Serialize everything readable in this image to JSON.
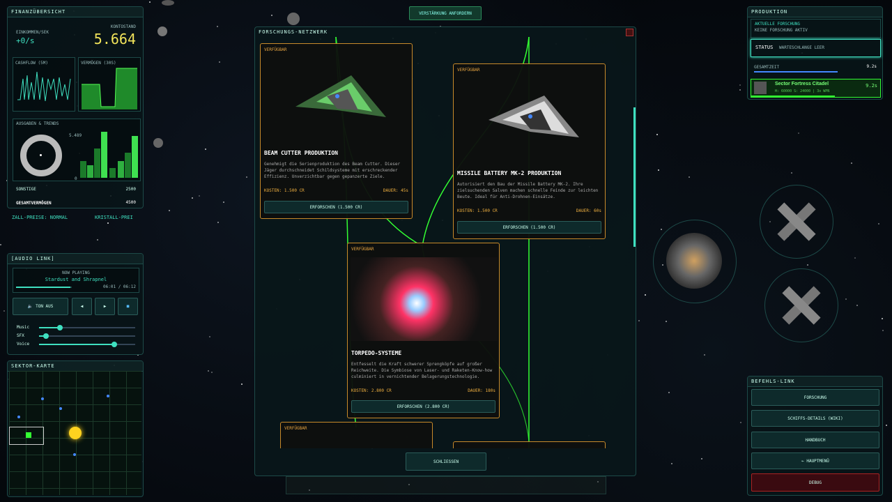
{
  "finance": {
    "title": "FINANZÜBERSICHT",
    "income_label": "EINKOMMEN/SEK",
    "income_value": "+0/s",
    "balance_label": "KONTOSTAND",
    "balance_value": "5.664",
    "cashflow_label": "CASHFLOW (5M)",
    "assets_label": "VERMÖGEN (30S)",
    "spending_label": "AUSGABEN & TRENDS",
    "chart_max": "5.489",
    "chart_min": "0",
    "other_label": "SONSTIGE",
    "other_value": "2500",
    "total_label": "GESAMTVERMÖGEN",
    "total_value": "4500",
    "ticker_left": "ZALL-PREISE: NORMAL",
    "ticker_right": "KRISTALL-PREI"
  },
  "audio": {
    "title": "[AUDIO LINK]",
    "now_playing": "NOW PLAYING",
    "track": "Stardust and Shrapnel",
    "time": "06:01 / 06:12",
    "progress": 0.97,
    "sound_button": "TON AUS",
    "music_label": "Music",
    "sfx_label": "SFX",
    "voice_label": "Voice",
    "music_level": 0.22,
    "sfx_level": 0.07,
    "voice_level": 0.78
  },
  "sector_map": {
    "title": "SEKTOR-KARTE"
  },
  "reinforce_button": "VERSTÄRKUNG ANFORDERN",
  "research": {
    "title": "FORSCHUNGS-NETZWERK",
    "close_button": "SCHLIESSEN",
    "cards": [
      {
        "avail": "VERFÜGBAR",
        "title": "BEAM CUTTER PRODUKTION",
        "desc": "Genehmigt die Serienproduktion des Beam Cutter. Dieser Jäger durchschneidet Schildsysteme mit erschreckender Effizienz. Unverzichtbar gegen gepanzerte Ziele.",
        "cost": "KOSTEN: 1.500 CR",
        "duration": "DAUER: 45s",
        "button": "ERFORSCHEN (1.500 CR)"
      },
      {
        "avail": "VERFÜGBAR",
        "title": "MISSILE BATTERY MK-2 PRODUKTION",
        "desc": "Autorisiert den Bau der Missile Battery MK-2. Ihre zielsuchenden Salven machen schnelle Feinde zur leichten Beute. Ideal für Anti-Drohnen-Einsätze.",
        "cost": "KOSTEN: 1.500 CR",
        "duration": "DAUER: 60s",
        "button": "ERFORSCHEN (1.500 CR)"
      },
      {
        "avail": "VERFÜGBAR",
        "title": "TORPEDO-SYSTEME",
        "desc": "Entfesselt die Kraft schwerer Sprengköpfe auf großer Reichweite. Die Symbiose von Laser- und Raketen-Know-how culminiert in vernichtender Belagerungstechnologie.",
        "cost": "KOSTEN: 2.800 CR",
        "duration": "DAUER: 180s",
        "button": "ERFORSCHEN (2.800 CR)"
      },
      {
        "avail": "VERFÜGBAR"
      }
    ]
  },
  "production": {
    "title": "PRODUKTION",
    "current_label": "AKTUELLE FORSCHUNG",
    "current_value": "KEINE FORSCHUNG AKTIV",
    "status_label": "STATUS",
    "status_value": "WARTESCHLANGE LEER",
    "total_time_label": "GESAMTZEIT",
    "total_time_value": "9.2s",
    "item_name": "Sector Fortress Citadel",
    "item_stats": "H: 60000 S: 24000 | 3x WPN",
    "item_time": "9.2s"
  },
  "command": {
    "title": "BEFEHLS-LINK",
    "buttons": [
      "FORSCHUNG",
      "SCHIFFS-DETAILS (WIKI)",
      "HANDBUCH",
      "← HAUPTMENÜ",
      "DEBUG"
    ]
  }
}
